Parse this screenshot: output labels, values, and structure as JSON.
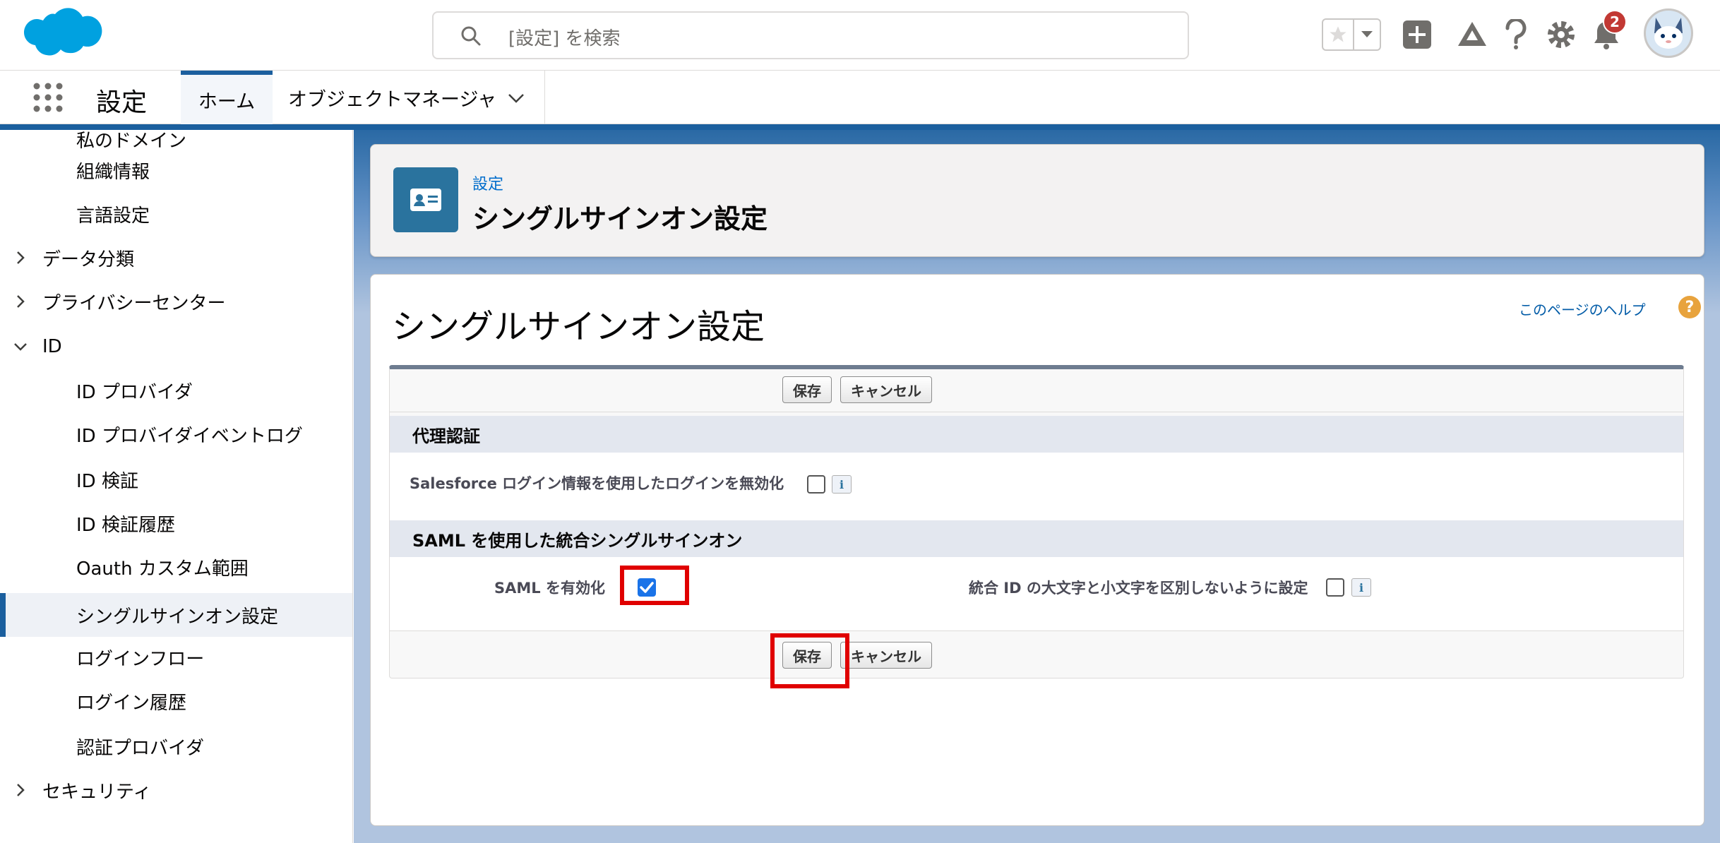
{
  "header": {
    "search_placeholder": "[設定] を検索",
    "notification_count": "2"
  },
  "nav": {
    "app_name": "設定",
    "tabs": [
      {
        "label": "ホーム"
      },
      {
        "label": "オブジェクトマネージャ"
      }
    ]
  },
  "sidebar": {
    "items": [
      {
        "label": "私のドメイン"
      },
      {
        "label": "組織情報"
      },
      {
        "label": "言語設定"
      },
      {
        "label": "データ分類"
      },
      {
        "label": "プライバシーセンター"
      },
      {
        "label": "ID"
      },
      {
        "label": "ID プロバイダ"
      },
      {
        "label": "ID プロバイダイベントログ"
      },
      {
        "label": "ID 検証"
      },
      {
        "label": "ID 検証履歴"
      },
      {
        "label": "Oauth カスタム範囲"
      },
      {
        "label": "シングルサインオン設定"
      },
      {
        "label": "ログインフロー"
      },
      {
        "label": "ログイン履歴"
      },
      {
        "label": "認証プロバイダ"
      },
      {
        "label": "セキュリティ"
      }
    ]
  },
  "page_header": {
    "breadcrumb": "設定",
    "title": "シングルサインオン設定"
  },
  "content": {
    "title": "シングルサインオン設定",
    "help_link": "このページのヘルプ",
    "help_icon": "?",
    "save_label": "保存",
    "cancel_label": "キャンセル",
    "section_delegated": "代理認証",
    "delegated_field": "Salesforce ログイン情報を使用したログインを無効化",
    "section_saml": "SAML を使用した統合シングルサインオン",
    "saml_enable_label": "SAML を有効化",
    "case_insensitive_label": "統合 ID の大文字と小文字を区別しないように設定",
    "info_glyph": "i",
    "saml_enabled": true,
    "delegated_disabled": false,
    "case_insensitive": false
  },
  "colors": {
    "brand": "#1b5f9e",
    "highlight": "#e00000",
    "link": "#006dcc"
  }
}
